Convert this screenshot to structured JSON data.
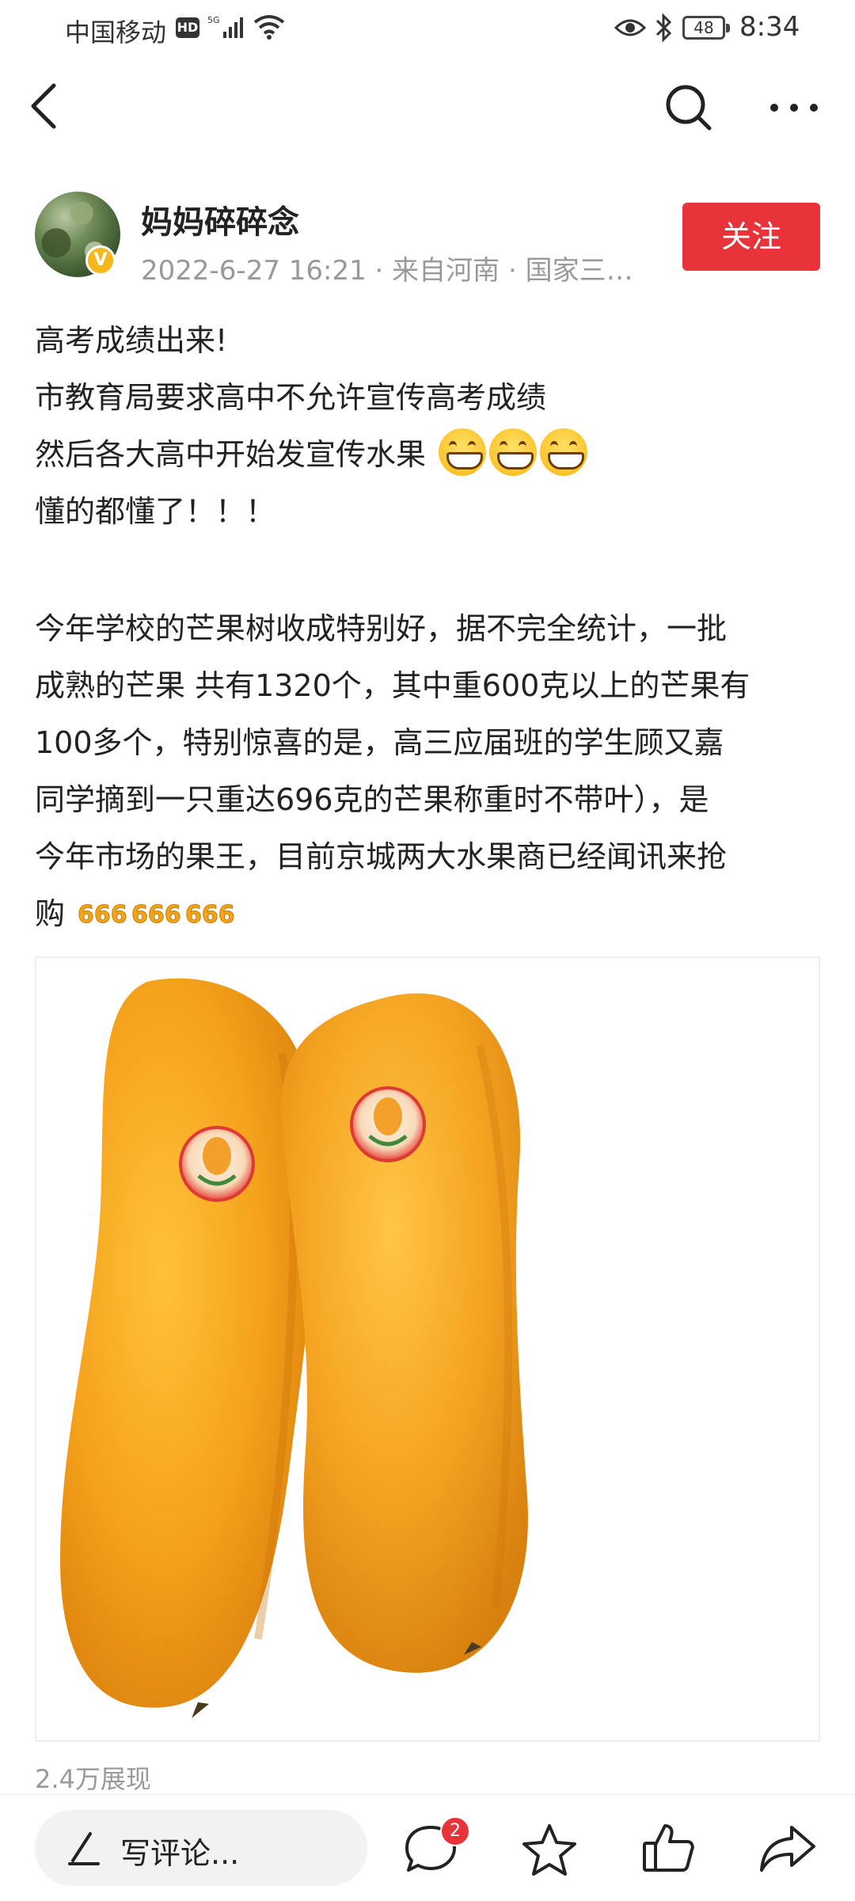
{
  "status_bar": {
    "carrier": "中国移动",
    "hd": "HD",
    "network": "5G",
    "battery": "48",
    "time": "8:34"
  },
  "nav": {
    "back_icon": "chevron-left-icon",
    "search_icon": "search-icon",
    "more_icon": "more-dots-icon"
  },
  "author": {
    "name": "妈妈碎碎念",
    "verified_badge": "V",
    "meta": "2022-6-27 16:21 · 来自河南 · 国家三…",
    "follow_label": "关注",
    "follow_color": "#e8333b"
  },
  "post": {
    "line1": "高考成绩出来!",
    "line2": "市教育局要求高中不允许宣传高考成绩",
    "line3": "然后各大高中开始发宣传水果",
    "line4": "懂的都懂了！！！",
    "para2_line1": "今年学校的芒果树收成特别好，据不完全统计，一批",
    "para2_line2": "成熟的芒果 共有1320个，其中重600克以上的芒果有",
    "para2_line3": "100多个，特别惊喜的是，高三应届班的学生顾又嘉",
    "para2_line4": "同学摘到一只重达696克的芒果称重时不带叶），是",
    "para2_line5": "今年市场的果王，目前京城两大水果商已经闻讯来抢",
    "para2_line6": "购",
    "grin_emoji": "grinning-face-icon",
    "emoji_666": "666-icon"
  },
  "image": {
    "subject": "two-mangoes-photo"
  },
  "stats": {
    "views": "2.4万展现"
  },
  "bottom_bar": {
    "comment_placeholder": "写评论...",
    "comment_count": "2",
    "accent": "#e8333b"
  }
}
